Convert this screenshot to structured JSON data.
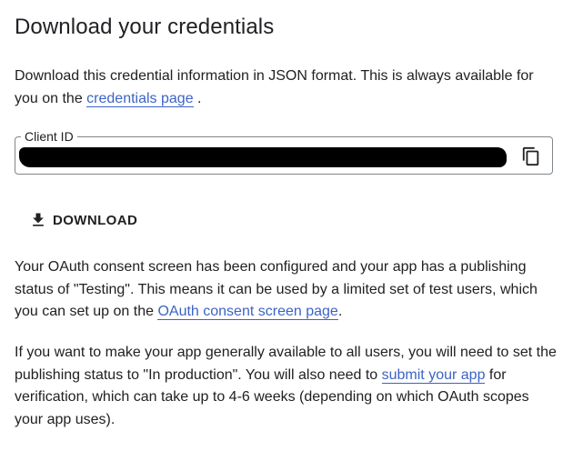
{
  "title": "Download your credentials",
  "intro": {
    "text_before": "Download this credential information in JSON format. This is always available for you on the ",
    "link": "credentials page",
    "text_after": " ."
  },
  "client_id": {
    "label": "Client ID",
    "value_redacted": true,
    "copy_icon": "copy-icon"
  },
  "download_button": {
    "label": "DOWNLOAD",
    "icon": "download-icon"
  },
  "consent": {
    "text_before": "Your OAuth consent screen has been configured and your app has a publishing status of \"Testing\". This means it can be used by a limited set of test users, which you can set up on the ",
    "link": "OAuth consent screen page",
    "text_after": "."
  },
  "production": {
    "text_before": "If you want to make your app generally available to all users, you will need to set the publishing status to \"In production\". You will also need to ",
    "link": "submit your app",
    "text_after": " for verification, which can take up to 4-6 weeks (depending on which OAuth scopes your app uses)."
  },
  "colors": {
    "link": "#3c63c6",
    "text": "#202124",
    "border": "#80868b"
  }
}
